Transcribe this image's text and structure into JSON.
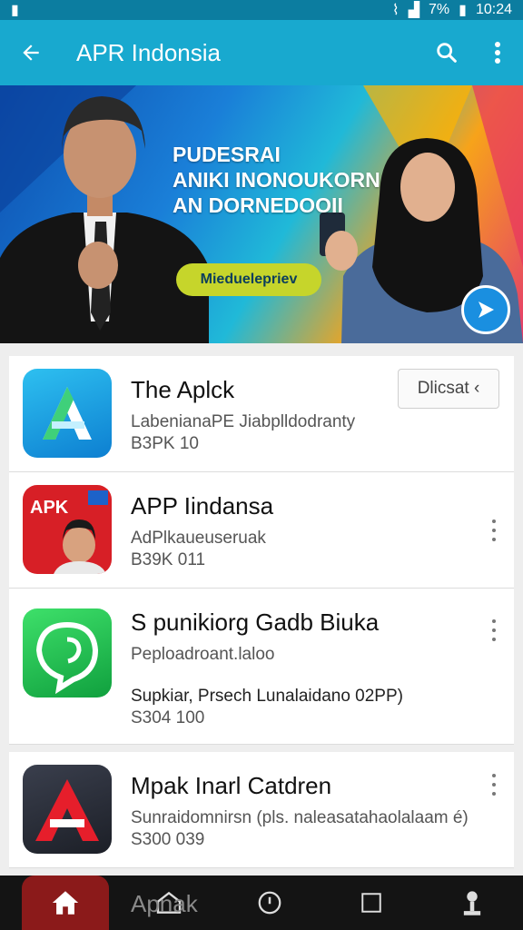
{
  "status": {
    "battery": "7%",
    "time": "10:24"
  },
  "appbar": {
    "title": "APR Indonsia",
    "back_icon": "arrow-left-icon",
    "search_icon": "search-icon",
    "overflow_icon": "more-vert-icon",
    "color": "#18a9cf"
  },
  "banner": {
    "line1": "PUDESRAI",
    "line2": "ANIKI INONOUKORN",
    "line3": "AN DORNEDOOII",
    "cta": "Mieduelepriev"
  },
  "apps": [
    {
      "name": "The Aplck",
      "developer": "LabenianaPE Jiabplldodranty",
      "meta": "B3PK 10",
      "action": "Dlicsat ‹"
    },
    {
      "name": "APP Iindansa",
      "developer": "AdPlkaueuseruak",
      "meta": "B39K 011",
      "icon_text": "APK"
    },
    {
      "name": "S punikiorg Gadb Biuka",
      "developer": "Peploadroant.laloo",
      "extra": "Supkiar, Prsech Lunalaidano 02PP)",
      "meta": "S304 100"
    },
    {
      "name": "Mpak Inarl Catdren",
      "developer": "Sunraidomnirsn (pls. naleasatahaolalaam é)",
      "meta": "S300 039"
    },
    {
      "name": "Apnak"
    }
  ],
  "navbar": {
    "items": [
      "home-icon",
      "store-icon",
      "discover-icon",
      "square-icon",
      "account-icon"
    ]
  }
}
